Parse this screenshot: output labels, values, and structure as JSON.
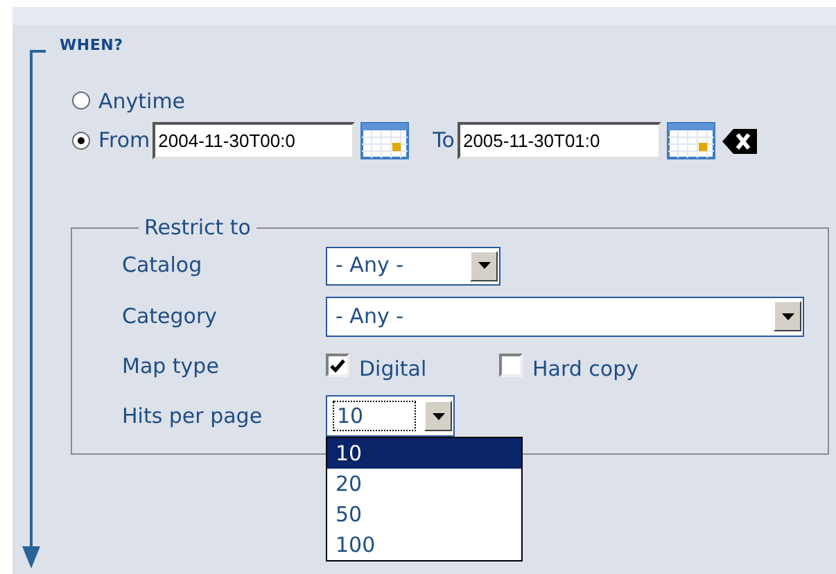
{
  "section": {
    "title": "WHEN?"
  },
  "time_options": [
    {
      "label": "Anytime",
      "selected": false
    },
    {
      "label": "From",
      "selected": true
    }
  ],
  "from_field": {
    "value": "2004-11-30T00:0"
  },
  "to_label": "To",
  "to_field": {
    "value": "2005-11-30T01:0"
  },
  "restrict": {
    "legend": "Restrict to",
    "catalog": {
      "label": "Catalog",
      "value": "- Any -"
    },
    "category": {
      "label": "Category",
      "value": "- Any -"
    },
    "map_type": {
      "label": "Map type",
      "options": [
        {
          "label": "Digital",
          "checked": true
        },
        {
          "label": "Hard copy",
          "checked": false
        }
      ]
    },
    "hits": {
      "label": "Hits per page",
      "value": "10",
      "expanded": true,
      "options": [
        {
          "label": "10",
          "selected": true
        },
        {
          "label": "20",
          "selected": false
        },
        {
          "label": "50",
          "selected": false
        },
        {
          "label": "100",
          "selected": false
        }
      ]
    }
  }
}
